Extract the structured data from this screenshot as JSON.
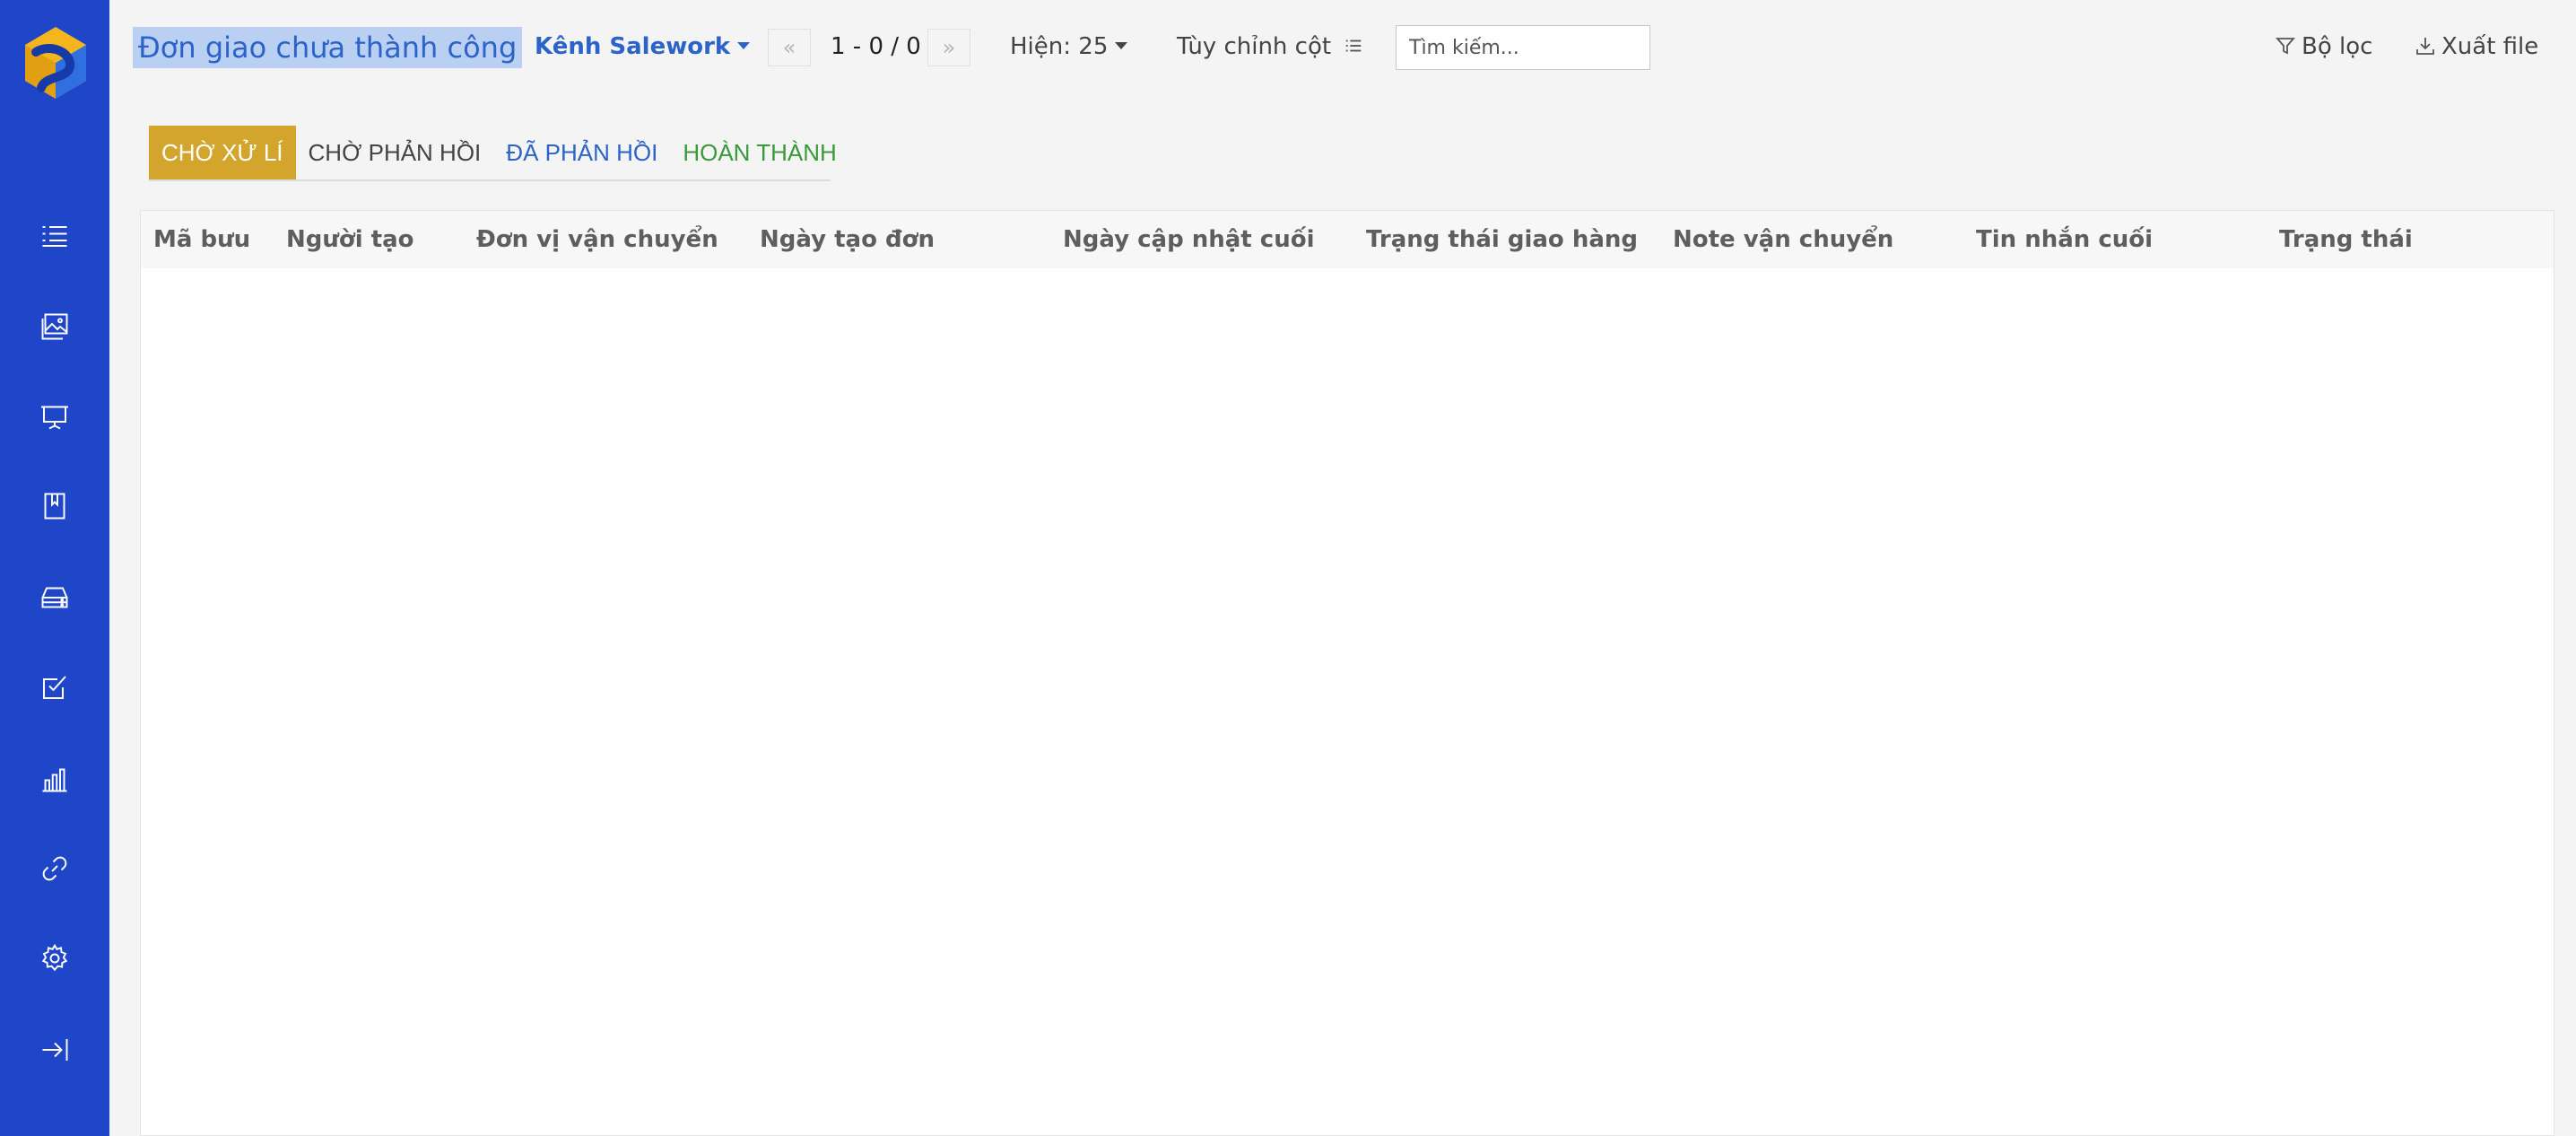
{
  "sidebar": {
    "items": [
      {
        "icon": "list-icon"
      },
      {
        "icon": "image-gallery-icon"
      },
      {
        "icon": "presentation-icon"
      },
      {
        "icon": "bookmark-book-icon"
      },
      {
        "icon": "storage-drive-icon"
      },
      {
        "icon": "checkbox-icon"
      },
      {
        "icon": "bar-chart-icon"
      },
      {
        "icon": "link-icon"
      },
      {
        "icon": "gear-icon"
      },
      {
        "icon": "logout-icon"
      }
    ],
    "color": "#1f46c8"
  },
  "header": {
    "title": "Đơn giao chưa thành công",
    "channel": "Kênh Salework",
    "pagination": "1 - 0 / 0",
    "show_count": "Hiện: 25",
    "custom_columns": "Tùy chỉnh cột",
    "search_placeholder": "Tìm kiếm...",
    "filter": "Bộ lọc",
    "export": "Xuất file"
  },
  "tabs": [
    {
      "label": "CHỜ XỬ LÍ",
      "active": true,
      "color": "#ffffff"
    },
    {
      "label": "CHỜ PHẢN HỒI",
      "active": false,
      "color": "#444444"
    },
    {
      "label": "ĐÃ PHẢN HỒI",
      "active": false,
      "color": "#2b63c9"
    },
    {
      "label": "HOÀN THÀNH",
      "active": false,
      "color": "#3a9a3a"
    }
  ],
  "table": {
    "columns": [
      "Mã bưu",
      "Người tạo",
      "Đơn vị vận chuyển",
      "Ngày tạo đơn",
      "Ngày cập nhật cuối",
      "Trạng thái giao hàng",
      "Note vận chuyển",
      "Tin nhắn cuối",
      "Trạng thái"
    ],
    "rows": []
  },
  "colors": {
    "accent": "#2b63c9",
    "active_tab": "#d3a52c",
    "title_highlight": "#b9d0f2"
  }
}
